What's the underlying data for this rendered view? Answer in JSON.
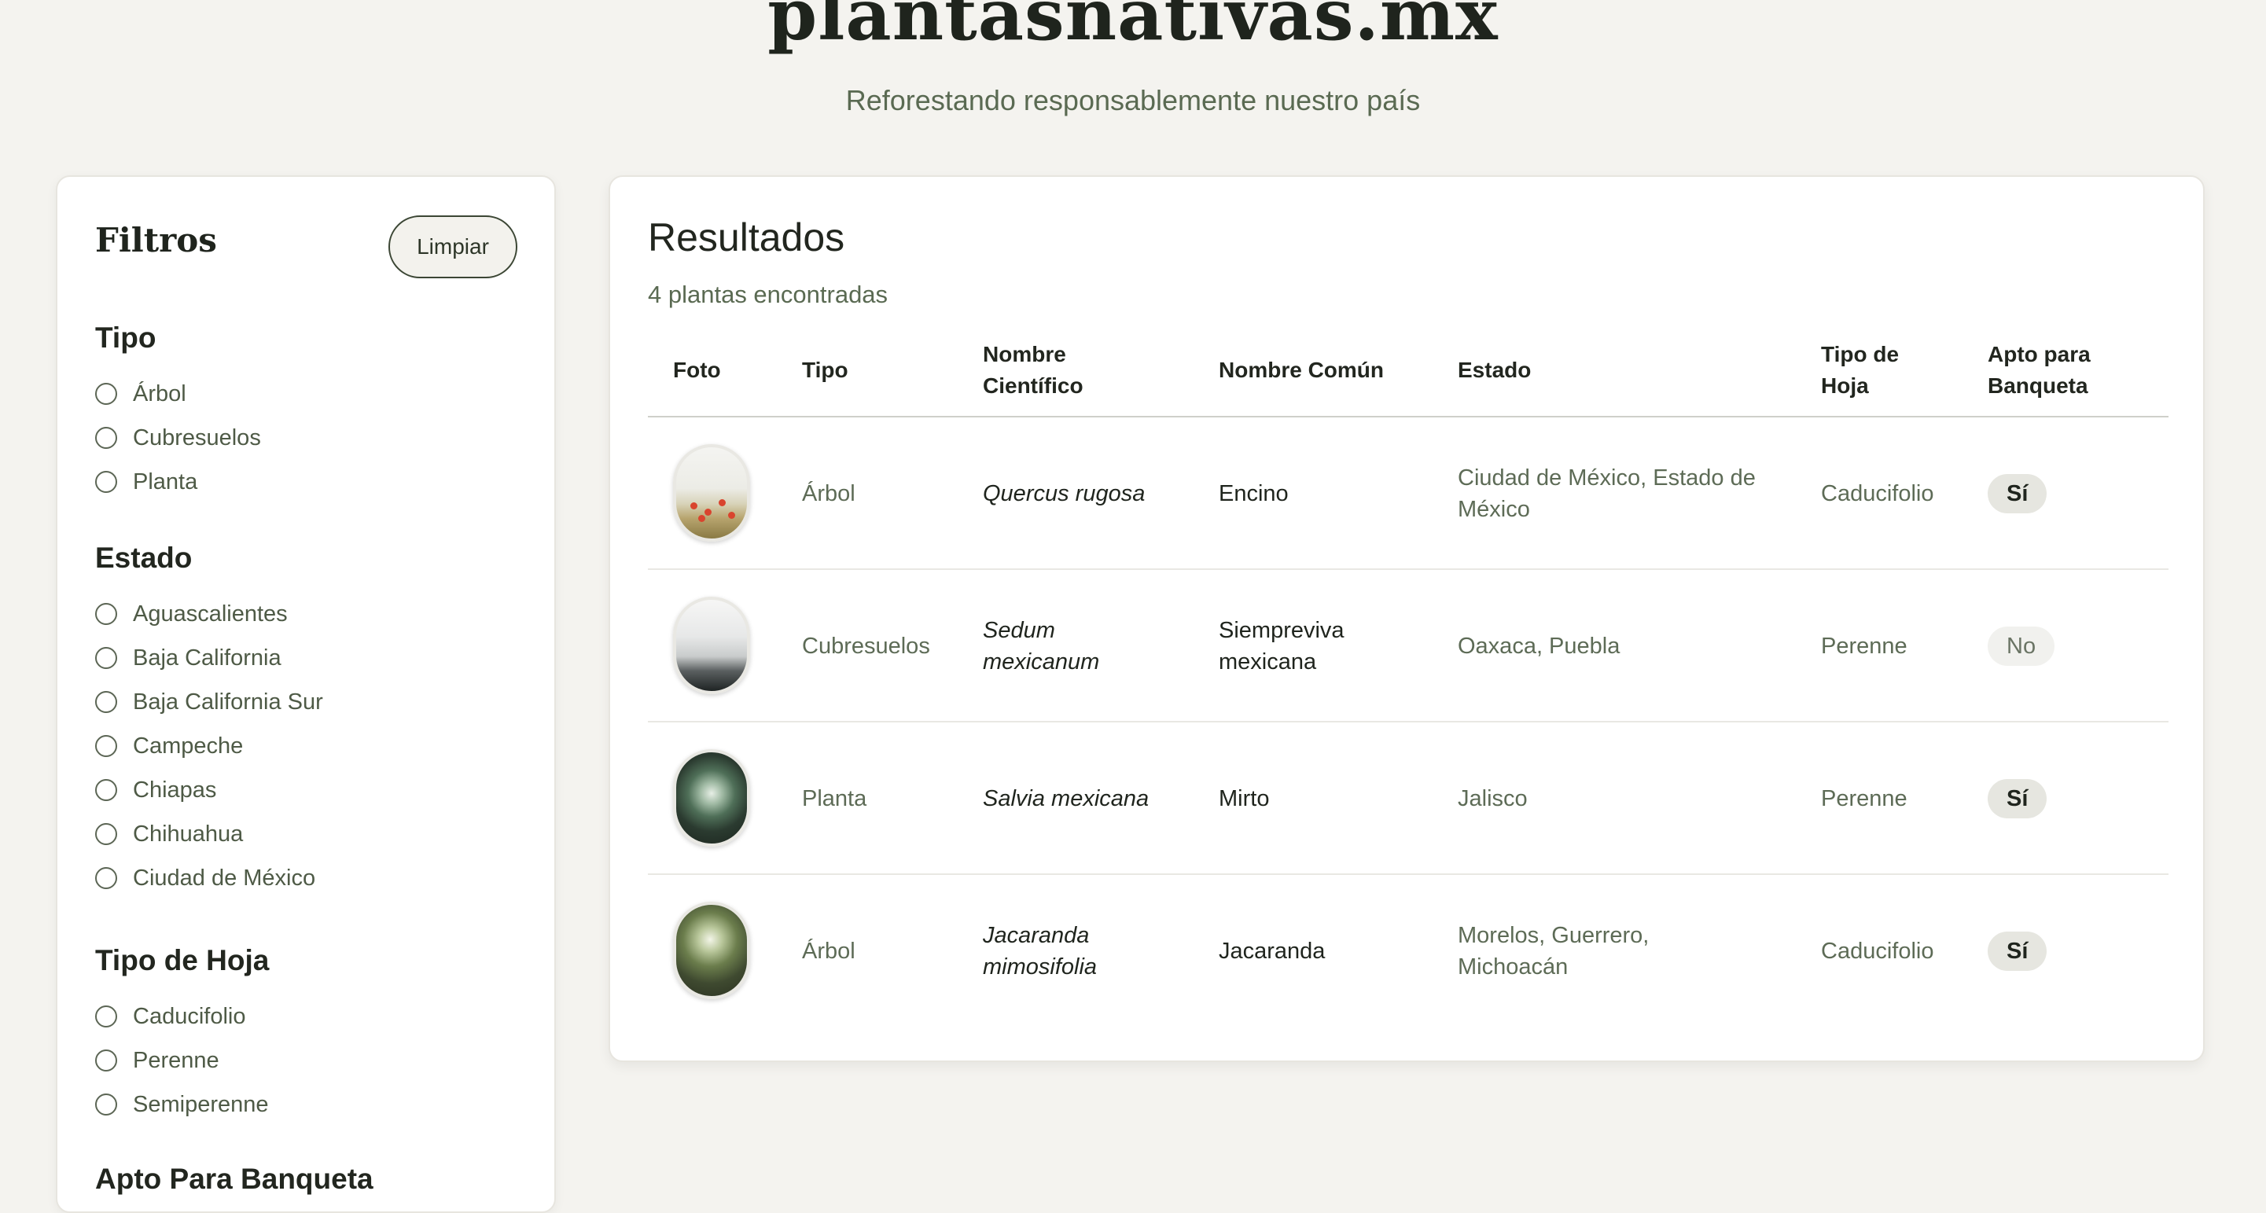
{
  "site": {
    "title": "plantasnativas.mx",
    "tagline": "Reforestando responsablemente nuestro país"
  },
  "filters": {
    "title": "Filtros",
    "clear_label": "Limpiar",
    "groups": [
      {
        "title": "Tipo",
        "options": [
          "Árbol",
          "Cubresuelos",
          "Planta"
        ]
      },
      {
        "title": "Estado",
        "options": [
          "Aguascalientes",
          "Baja California",
          "Baja California Sur",
          "Campeche",
          "Chiapas",
          "Chihuahua",
          "Ciudad de México"
        ]
      },
      {
        "title": "Tipo de Hoja",
        "options": [
          "Caducifolio",
          "Perenne",
          "Semiperenne"
        ]
      },
      {
        "title": "Apto Para Banqueta",
        "options": []
      }
    ]
  },
  "results": {
    "title": "Resultados",
    "count_text": "4 plantas encontradas",
    "columns": {
      "foto": "Foto",
      "tipo": "Tipo",
      "nombre_cientifico_1": "Nombre",
      "nombre_cientifico_2": "Científico",
      "nombre_comun": "Nombre Común",
      "estado": "Estado",
      "tipo_hoja_1": "Tipo de",
      "tipo_hoja_2": "Hoja",
      "apto_1": "Apto para",
      "apto_2": "Banqueta"
    },
    "rows": [
      {
        "tipo": "Árbol",
        "cientifico_1": "Quercus rugosa",
        "cientifico_2": "",
        "comun_1": "Encino",
        "comun_2": "",
        "estado_1": "Ciudad de México, Estado de",
        "estado_2": "México",
        "hoja": "Caducifolio",
        "apto": "Sí",
        "photo_icon": "wildflower-meadow-photo"
      },
      {
        "tipo": "Cubresuelos",
        "cientifico_1": "Sedum",
        "cientifico_2": "mexicanum",
        "comun_1": "Siempreviva",
        "comun_2": "mexicana",
        "estado_1": "Oaxaca, Puebla",
        "estado_2": "",
        "hoja": "Perenne",
        "apto": "No",
        "photo_icon": "misty-forest-photo"
      },
      {
        "tipo": "Planta",
        "cientifico_1": "Salvia mexicana",
        "cientifico_2": "",
        "comun_1": "Mirto",
        "comun_2": "",
        "estado_1": "Jalisco",
        "estado_2": "",
        "hoja": "Perenne",
        "apto": "Sí",
        "photo_icon": "forest-canopy-photo"
      },
      {
        "tipo": "Árbol",
        "cientifico_1": "Jacaranda",
        "cientifico_2": "mimosifolia",
        "comun_1": "Jacaranda",
        "comun_2": "",
        "estado_1": "Morelos, Guerrero,",
        "estado_2": "Michoacán",
        "hoja": "Caducifolio",
        "apto": "Sí",
        "photo_icon": "tree-canopy-photo"
      }
    ]
  }
}
